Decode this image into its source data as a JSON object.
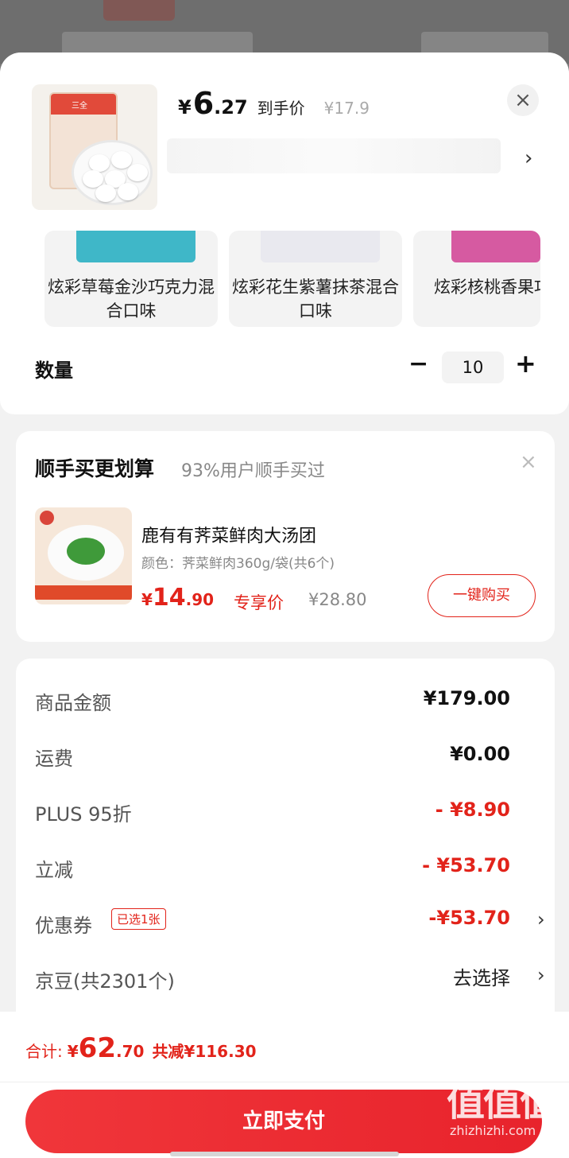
{
  "product": {
    "price_yen": "¥",
    "price_int": "6",
    "price_dec": ".27",
    "price_label": "到手价",
    "orig_price": "¥17.9",
    "thumb_text": "三全"
  },
  "variants": [
    {
      "label": "炫彩草莓金沙巧克力混合口味",
      "color": "#3fb7c8"
    },
    {
      "label": "炫彩花生紫薯抹茶混合口味",
      "color": "#c9a8e0"
    },
    {
      "label": "炫彩核桃香果巧克力混合",
      "color": "#d65aa1"
    }
  ],
  "quantity": {
    "label": "数量",
    "minus": "−",
    "value": "10",
    "plus": "+"
  },
  "upsell": {
    "title": "顺手买更划算",
    "subtitle": "93%用户顺手买过",
    "item_name": "鹿有有荠菜鲜肉大汤团",
    "item_spec": "颜色：荠菜鲜肉360g/袋(共6个)",
    "price_yen": "¥",
    "price_int": "14",
    "price_dec": ".90",
    "price_label": "专享价",
    "orig_price": "¥28.80",
    "buy_label": "一键购买"
  },
  "summary": {
    "rows": [
      {
        "label": "商品金额",
        "value": "¥179.00"
      },
      {
        "label": "运费",
        "value": "¥0.00"
      },
      {
        "label": "PLUS 95折",
        "value": "- ¥8.90"
      },
      {
        "label": "立减",
        "value": "- ¥53.70"
      },
      {
        "label": "优惠券",
        "value": "-¥53.70",
        "tag": "已选1张"
      },
      {
        "label": "京豆(共2301个)",
        "value": "去选择"
      }
    ]
  },
  "footer": {
    "total_label": "合计:",
    "total_yen": "¥",
    "total_int": "62",
    "total_dec": ".70",
    "saved": "共减¥116.30",
    "pay_label": "立即支付"
  },
  "watermark": {
    "big": "值值值",
    "small": "zhizhizhi.com"
  },
  "colors": {
    "accent": "#e2231a",
    "sheet_bg": "#f2f2f2"
  }
}
